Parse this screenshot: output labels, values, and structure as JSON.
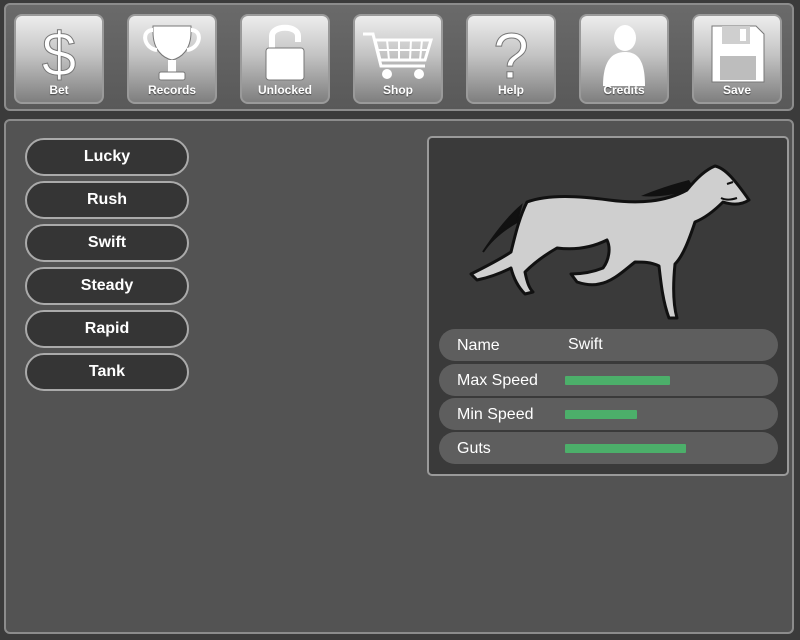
{
  "toolbar": {
    "buttons": [
      {
        "label": "Bet",
        "icon": "dollar-icon"
      },
      {
        "label": "Records",
        "icon": "trophy-icon"
      },
      {
        "label": "Unlocked",
        "icon": "lock-icon"
      },
      {
        "label": "Shop",
        "icon": "cart-icon"
      },
      {
        "label": "Help",
        "icon": "question-icon"
      },
      {
        "label": "Credits",
        "icon": "person-icon"
      },
      {
        "label": "Save",
        "icon": "floppy-disk-icon"
      }
    ]
  },
  "dogs": [
    "Lucky",
    "Rush",
    "Swift",
    "Steady",
    "Rapid",
    "Tank"
  ],
  "detail": {
    "name_label": "Name",
    "name_value": "Swift",
    "stats": [
      {
        "label": "Max Speed",
        "level": 0.51
      },
      {
        "label": "Min Speed",
        "level": 0.35
      },
      {
        "label": "Guts",
        "level": 0.59
      }
    ]
  },
  "colors": {
    "bar": "#4caf6a",
    "panel": "#535353",
    "button_dark": "#353535"
  }
}
